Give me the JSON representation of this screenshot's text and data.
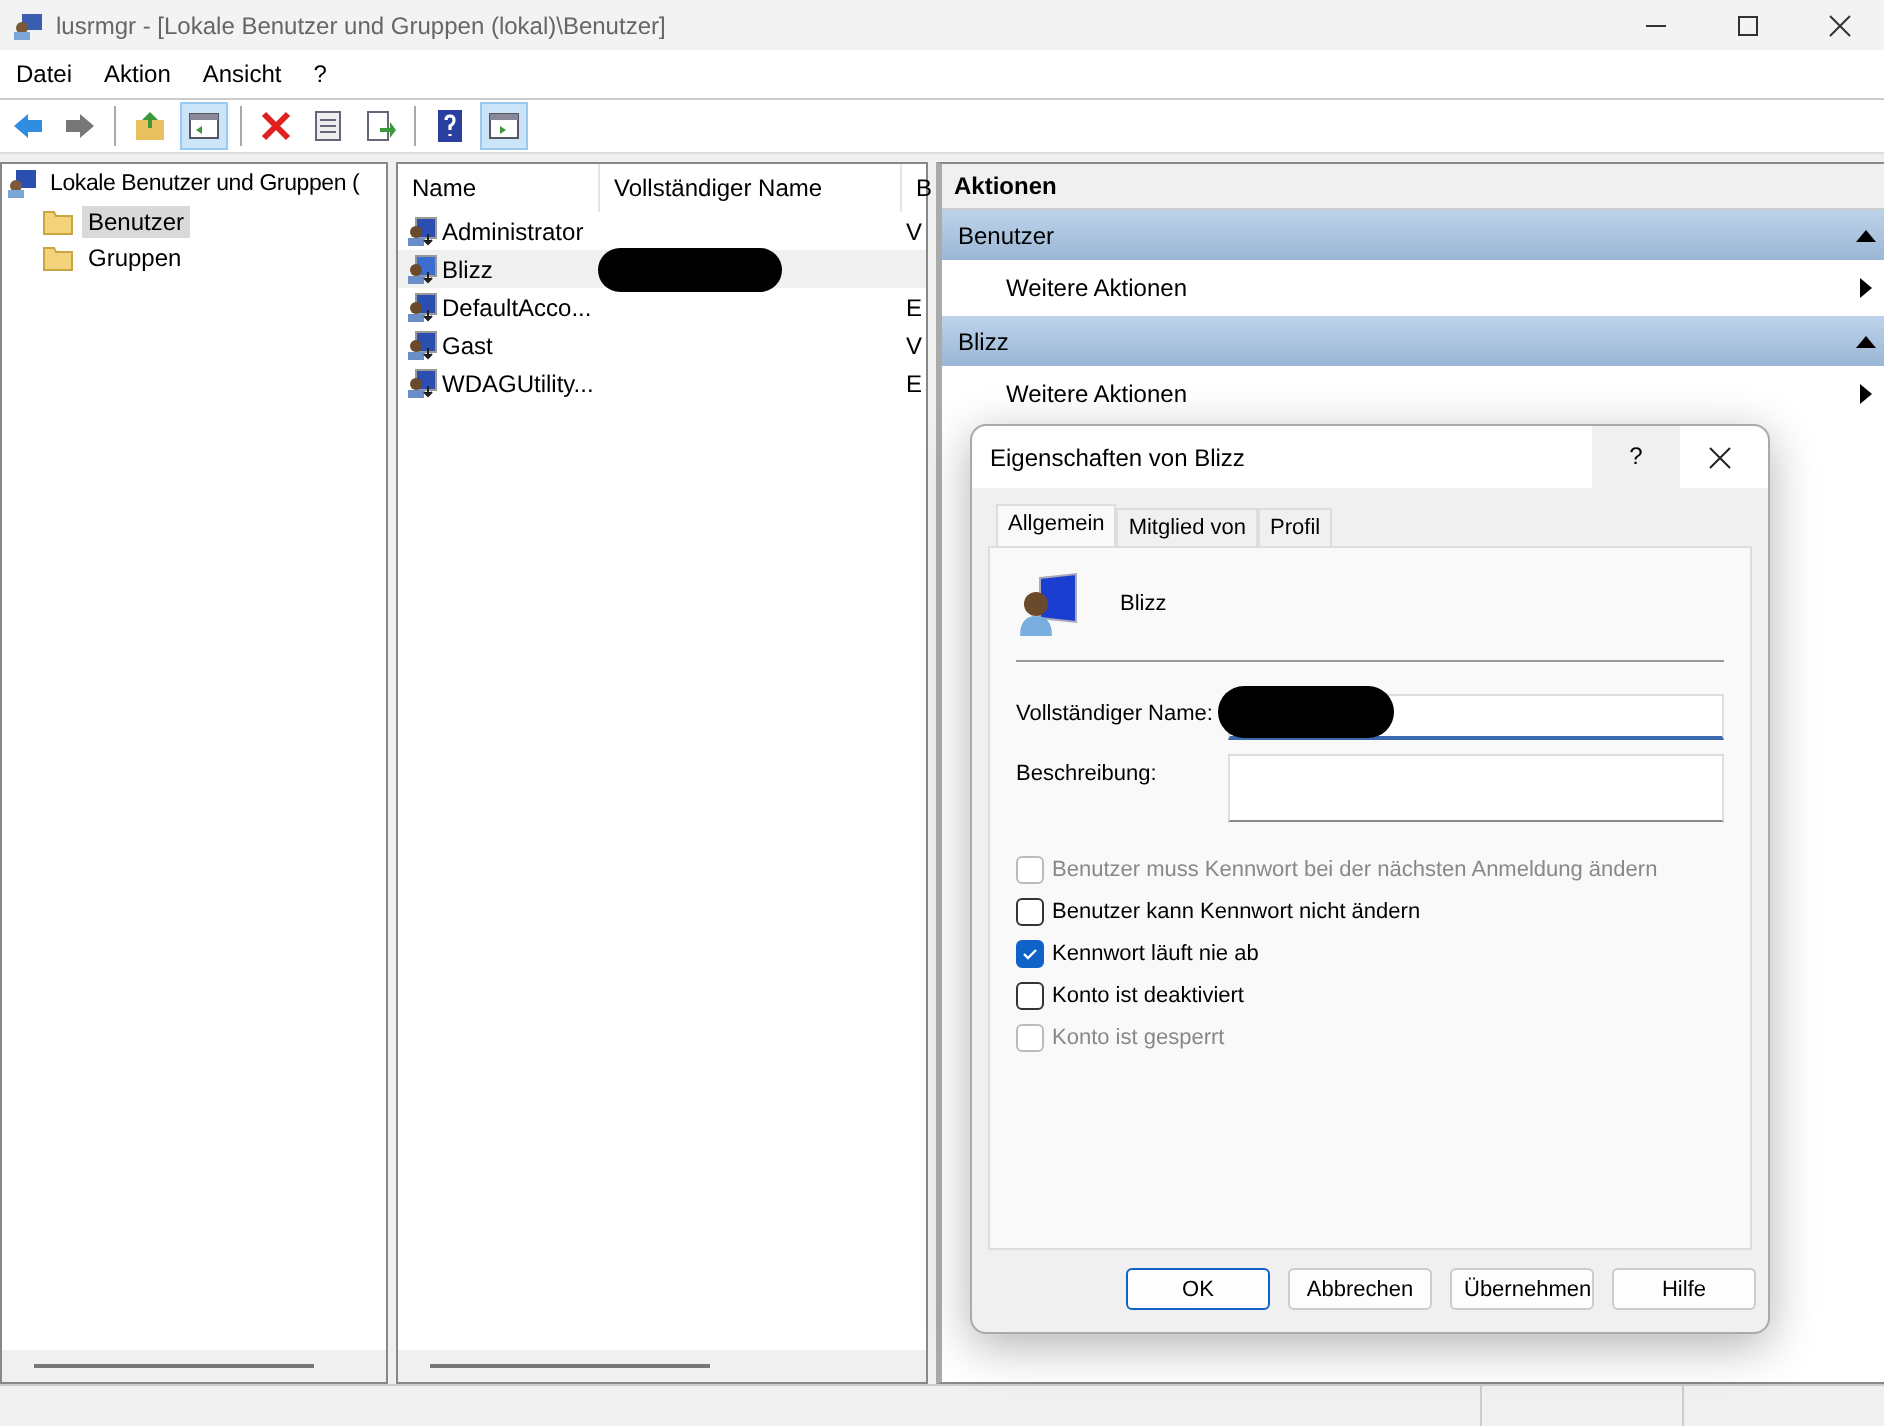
{
  "window": {
    "title": "lusrmgr - [Lokale Benutzer und Gruppen (lokal)\\Benutzer]"
  },
  "menu": [
    "Datei",
    "Aktion",
    "Ansicht",
    "?"
  ],
  "tree": {
    "label": "Lokale Benutzer und Gruppen (",
    "children": [
      {
        "label": "Benutzer",
        "selected": true
      },
      {
        "label": "Gruppen",
        "selected": false
      }
    ]
  },
  "table": {
    "columns": [
      "Name",
      "Vollständiger Name",
      "B"
    ],
    "rows": [
      {
        "name": "Administrator",
        "column_3": "V",
        "selected": false,
        "redacted": false
      },
      {
        "name": "Blizz",
        "column_3": "",
        "selected": true,
        "redacted": true
      },
      {
        "name": "DefaultAcco...",
        "column_3": "E",
        "selected": false,
        "redacted": false
      },
      {
        "name": "Gast",
        "column_3": "V",
        "selected": false,
        "redacted": false
      },
      {
        "name": "WDAGUtility...",
        "column_3": "E",
        "selected": false,
        "redacted": false
      }
    ]
  },
  "actions": {
    "title": "Aktionen",
    "groups": [
      {
        "label": "Benutzer",
        "expanded": true,
        "items": [
          "Weitere Aktionen"
        ]
      },
      {
        "label": "Blizz",
        "expanded": true,
        "items": [
          "Weitere Aktionen"
        ]
      }
    ]
  },
  "dialog": {
    "title": "Eigenschaften von Blizz",
    "help": "?",
    "tabs": [
      {
        "label": "Allgemein",
        "selected": true
      },
      {
        "label": "Mitglied von",
        "selected": false
      },
      {
        "label": "Profil",
        "selected": false
      }
    ],
    "user": "Blizz",
    "fields": [
      {
        "label": "Vollständiger Name:",
        "redacted": true,
        "focused": true
      },
      {
        "label": "Beschreibung:",
        "redacted": false,
        "focused": false
      }
    ],
    "checkboxes": [
      {
        "label": "Benutzer muss Kennwort bei der nächsten Anmeldung ändern",
        "checked": false,
        "disabled": true
      },
      {
        "label": "Benutzer kann Kennwort nicht ändern",
        "checked": false,
        "disabled": false
      },
      {
        "label": "Kennwort läuft nie ab",
        "checked": true,
        "disabled": false
      },
      {
        "label": "Konto ist deaktiviert",
        "checked": false,
        "disabled": false
      },
      {
        "label": "Konto ist gesperrt",
        "checked": false,
        "disabled": true
      }
    ],
    "buttons": [
      {
        "label": "OK",
        "default": true
      },
      {
        "label": "Abbrechen",
        "default": false
      },
      {
        "label": "Übernehmen",
        "default": false
      },
      {
        "label": "Hilfe",
        "default": false
      }
    ]
  }
}
